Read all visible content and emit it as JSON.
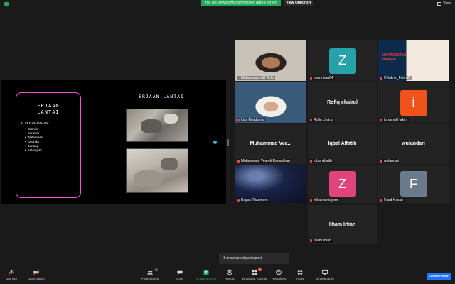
{
  "top": {
    "banner": "You are viewing Muhammad Alif Aufa's screen",
    "view_options": "View Options ▾",
    "view": "View"
  },
  "slide": {
    "card_title_1": "ERJAAN",
    "card_title_2": "LANTAI",
    "card_subtitle": "ALAT DAN BAHAN :",
    "items": [
      "Granite",
      "Keramik",
      "Waterpass",
      "Gerinda",
      "Benang",
      "Selang air"
    ],
    "right_title": "ERJAAN LANTAI"
  },
  "participants_grid": [
    {
      "name": "Muhammad Alif Aufa",
      "type": "video",
      "active": true
    },
    {
      "name": "zoom baa04",
      "type": "avatar",
      "letter": "Z",
      "color": "#27a2a8"
    },
    {
      "name": "UBakrie_Fatin A.",
      "type": "video"
    },
    {
      "name": "Lisa Rosdiana",
      "type": "video"
    },
    {
      "name": "Rofiq chairul",
      "type": "name",
      "display": "Rofiq chairul"
    },
    {
      "name": "fonamul Hakim",
      "type": "avatar",
      "letter": "i",
      "color": "#f0521b"
    },
    {
      "name": "Muhammad Veareli Ramadhan",
      "type": "name",
      "display": "Muhammad Vea..."
    },
    {
      "name": "Iqbal Alfatih",
      "type": "name",
      "display": "Iqbal Alfatih"
    },
    {
      "name": "wulandari",
      "type": "name",
      "display": "wulandari"
    },
    {
      "name": "Bagas Triasmoro",
      "type": "video"
    },
    {
      "name": "zili aprianisyem",
      "type": "avatar",
      "letter": "Z",
      "color": "#e0447c"
    },
    {
      "name": "Fuad Hasan",
      "type": "avatar",
      "letter": "F",
      "color": "#6b7b8c"
    },
    {
      "name": "Ilham Irfian",
      "type": "name",
      "display": "Ilham Irfian"
    }
  ],
  "unassigned": "1 unassigned participant",
  "toolbar": {
    "unmute": "Unmute",
    "start_video": "Start Video",
    "participants": "Participants",
    "participants_count": "13",
    "chat": "Chat",
    "share_screen": "Share Screen",
    "record": "Record",
    "breakout_rooms": "Breakout Rooms",
    "reactions": "Reactions",
    "apps": "Apps",
    "whiteboards": "Whiteboards",
    "leave": "Leave Room"
  },
  "colors": {
    "accent_green": "#23a55a",
    "active_outline": "#e9ff5b",
    "slide_pink": "#ff4fd8",
    "leave_blue": "#1e73ff"
  }
}
